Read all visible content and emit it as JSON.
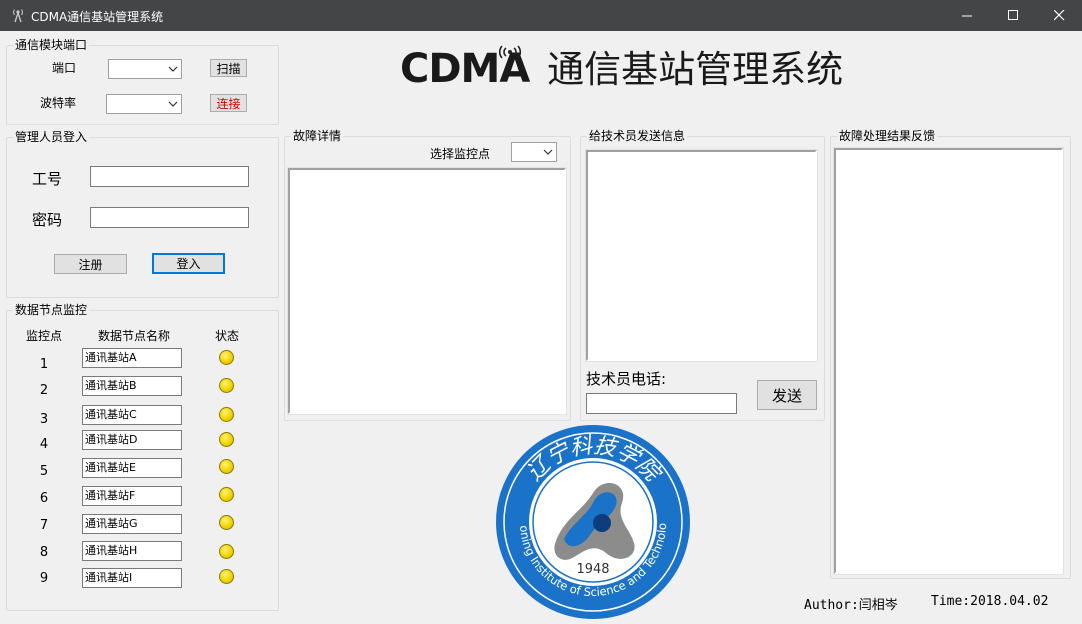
{
  "window": {
    "title": "CDMA通信基站管理系统",
    "minimize": "—",
    "maximize": "☐",
    "close": "✕"
  },
  "banner": {
    "logo_text": "CDMA",
    "title": "通信基站管理系统"
  },
  "port_group": {
    "title": "通信模块端口",
    "port_label": "端口",
    "scan_button": "扫描",
    "baud_label": "波特率",
    "connect_button": "连接",
    "connect_color": "#d40000"
  },
  "login_group": {
    "title": "管理人员登入",
    "id_label": "工号",
    "password_label": "密码",
    "register_button": "注册",
    "login_button": "登入"
  },
  "monitor_group": {
    "title": "数据节点监控",
    "headers": {
      "point": "监控点",
      "name": "数据节点名称",
      "status": "状态"
    },
    "rows": [
      {
        "num": "1",
        "name": "通讯基站A"
      },
      {
        "num": "2",
        "name": "通讯基站B"
      },
      {
        "num": "3",
        "name": "通讯基站C"
      },
      {
        "num": "4",
        "name": "通讯基站D"
      },
      {
        "num": "5",
        "name": "通讯基站E"
      },
      {
        "num": "6",
        "name": "通讯基站F"
      },
      {
        "num": "7",
        "name": "通讯基站G"
      },
      {
        "num": "8",
        "name": "通讯基站H"
      },
      {
        "num": "9",
        "name": "通讯基站I"
      }
    ],
    "status_color": "#f2d400"
  },
  "fault_group": {
    "title": "故障详情",
    "select_label": "选择监控点"
  },
  "send_group": {
    "title": "给技术员发送信息",
    "phone_label": "技术员电话:",
    "send_button": "发送"
  },
  "feedback_group": {
    "title": "故障处理结果反馈"
  },
  "emblem": {
    "chinese": "辽宁科技学院",
    "english": "Liaoning Institute of Science and Technology",
    "year": "1948",
    "color": "#1a73c8"
  },
  "footer": {
    "author": "Author:闫相岑",
    "time": "Time:2018.04.02"
  }
}
